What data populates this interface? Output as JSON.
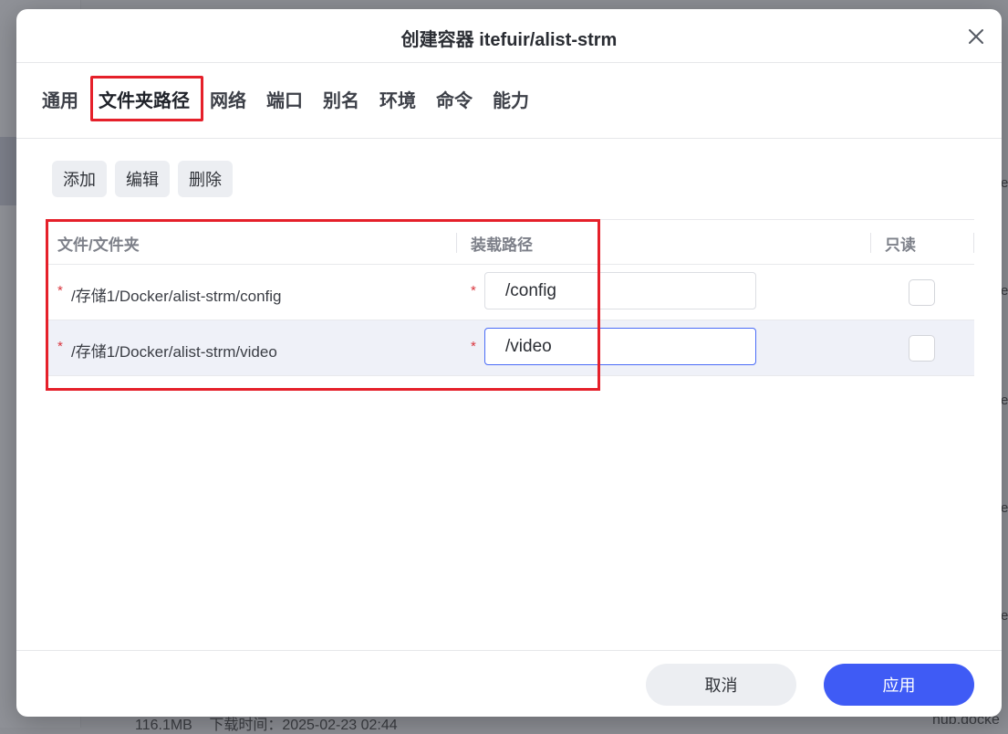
{
  "dialog": {
    "title": "创建容器 itefuir/alist-strm",
    "close_icon": "close-icon"
  },
  "tabs": [
    {
      "label": "通用"
    },
    {
      "label": "文件夹路径",
      "active": true
    },
    {
      "label": "网络"
    },
    {
      "label": "端口"
    },
    {
      "label": "别名"
    },
    {
      "label": "环境"
    },
    {
      "label": "命令"
    },
    {
      "label": "能力"
    }
  ],
  "toolbar": {
    "add_label": "添加",
    "edit_label": "编辑",
    "delete_label": "删除"
  },
  "table": {
    "columns": [
      "文件/文件夹",
      "装载路径",
      "只读"
    ],
    "rows": [
      {
        "required_mark": "*",
        "path": "/存储1/Docker/alist-strm/config",
        "mount_required_mark": "*",
        "mount": "/config",
        "read_only": false
      },
      {
        "required_mark": "*",
        "path": "/存储1/Docker/alist-strm/video",
        "mount_required_mark": "*",
        "mount": "/video",
        "read_only": false
      }
    ]
  },
  "footer": {
    "cancel_label": "取消",
    "apply_label": "应用"
  },
  "background": {
    "bottom_size": "116.1MB",
    "bottom_text": "下载时间：2025-02-23 02:44",
    "bottom_right": "hub.docke",
    "side_fragments": [
      "e",
      "e",
      "e",
      "e",
      "e",
      "e"
    ]
  },
  "colors": {
    "accent": "#3f5bf5",
    "highlight_box": "#e5202a",
    "required": "#d9363e"
  }
}
